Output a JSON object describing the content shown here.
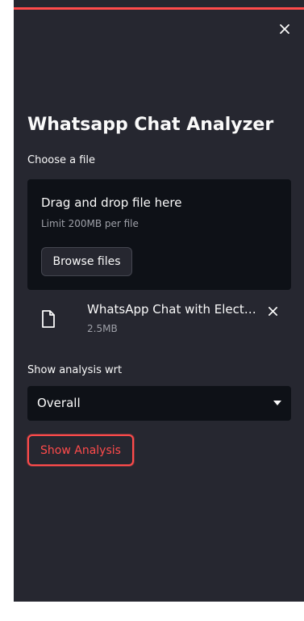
{
  "sidebar": {
    "accent_color": "#ff4b4b",
    "background_color": "#262730",
    "close_icon": "close-icon",
    "title": "Whatsapp Chat Analyzer"
  },
  "uploader": {
    "label": "Choose a file",
    "drop_text": "Drag and drop file here",
    "limit_text": "Limit 200MB per file",
    "browse_label": "Browse files",
    "file": {
      "icon": "file-icon",
      "name": "WhatsApp Chat with Electr…",
      "size": "2.5MB",
      "remove_icon": "close-icon"
    }
  },
  "select": {
    "label": "Show analysis wrt",
    "value": "Overall",
    "icon": "caret-down-icon"
  },
  "action": {
    "label": "Show Analysis"
  }
}
